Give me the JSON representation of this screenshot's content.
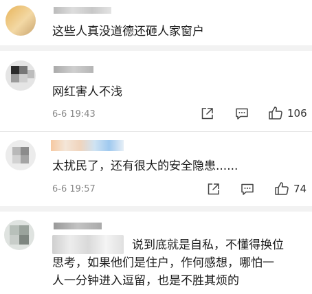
{
  "comments": [
    {
      "text_lines": [
        "这些人真没道德还砸人家窗户"
      ]
    },
    {
      "text_lines": [
        "网红害人不浅"
      ],
      "time": "6-6 19:43",
      "likes": "106"
    },
    {
      "text_lines": [
        "太扰民了，还有很大的安全隐患......"
      ],
      "time": "6-6 19:57",
      "likes": "74"
    },
    {
      "text_lines": [
        "说到底就是自私，不懂得换位",
        "思考，如果他们是住户，作何感想，哪怕一",
        "人一分钟进入逗留，也是不胜其烦的"
      ]
    }
  ],
  "icons": {
    "share": "share-icon",
    "reply": "comment-icon",
    "like": "thumbs-up-icon"
  }
}
